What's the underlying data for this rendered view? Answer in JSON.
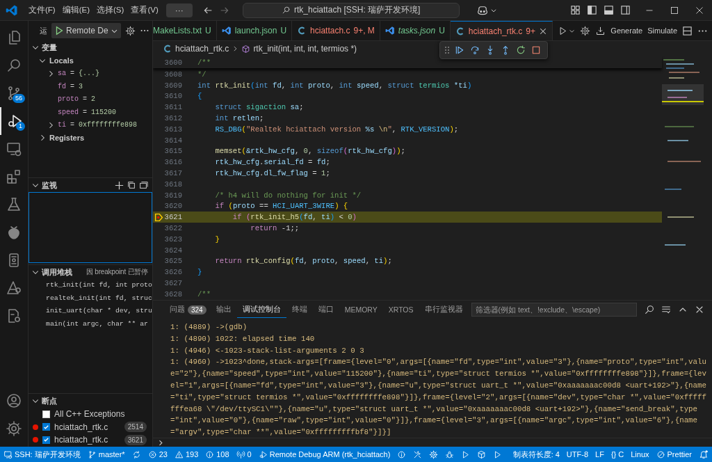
{
  "title_bar": {
    "menus": [
      "文件(F)",
      "编辑(E)",
      "选择(S)",
      "查看(V)"
    ],
    "more": "···",
    "command_center": "rtk_hciattach [SSH: 瑞萨开发环境]"
  },
  "activity_bar": {
    "top": [
      {
        "kind": "explorer",
        "selected": false
      },
      {
        "kind": "search",
        "selected": false
      },
      {
        "kind": "source-control",
        "selected": false,
        "badge": "56"
      },
      {
        "kind": "debug",
        "selected": true,
        "badge": "1"
      },
      {
        "kind": "remote",
        "selected": false
      },
      {
        "kind": "extensions",
        "selected": false
      },
      {
        "kind": "testing",
        "selected": false
      },
      {
        "kind": "berry",
        "selected": false
      },
      {
        "kind": "device",
        "selected": false
      },
      {
        "kind": "triangle",
        "selected": false
      },
      {
        "kind": "file-gear",
        "selected": false
      }
    ],
    "bottom": [
      {
        "kind": "account",
        "selected": false
      },
      {
        "kind": "settings",
        "selected": false
      }
    ]
  },
  "sidebar": {
    "title": "运",
    "configuration": "Remote De",
    "variables": {
      "title": "变量",
      "expanded": true,
      "scopes": [
        {
          "label": "Locals",
          "expanded": true,
          "items": [
            {
              "name": "sa",
              "operator": "=",
              "value": "{...}",
              "expandable": true
            },
            {
              "name": "fd",
              "operator": "=",
              "value": "3",
              "expandable": false
            },
            {
              "name": "proto",
              "operator": "=",
              "value": "2",
              "expandable": false
            },
            {
              "name": "speed",
              "operator": "=",
              "value": "115200",
              "expandable": false
            },
            {
              "name": "ti",
              "operator": "=",
              "value": "0xffffffffe898",
              "expandable": true
            }
          ]
        },
        {
          "label": "Registers",
          "expanded": false
        }
      ]
    },
    "watch": {
      "title": "监视",
      "expanded": true
    },
    "call_stack": {
      "title": "调用堆栈",
      "expanded": true,
      "status": "因 breakpoint 已暂停",
      "frames": [
        "rtk_init(int fd, int proto",
        "realtek_init(int fd, struc",
        "init_uart(char * dev, stru",
        "main(int argc, char ** ar"
      ]
    },
    "breakpoints": {
      "title": "断点",
      "expanded": true,
      "items": [
        {
          "label": "All C++ Exceptions",
          "kind": "exception",
          "checked": false
        },
        {
          "label": "hciattach_rtk.c",
          "kind": "line",
          "checked": true,
          "line": "2514"
        },
        {
          "label": "hciattach_rtk.c",
          "kind": "line",
          "checked": true,
          "line": "3621"
        }
      ]
    }
  },
  "editor": {
    "tabs": [
      {
        "label": "MakeLists.txt",
        "status": "U",
        "color": "#73c991",
        "preview": false,
        "selected": false
      },
      {
        "label": "launch.json",
        "kind": "json",
        "status": "U",
        "color": "#73c991",
        "preview": false,
        "selected": false
      },
      {
        "label": "hciattach.c",
        "kind": "c",
        "status": "9+, M",
        "color": "#f88070",
        "preview": false,
        "selected": false
      },
      {
        "label": "tasks.json",
        "kind": "json",
        "status": "U",
        "color": "#73c991",
        "preview": true,
        "selected": false
      },
      {
        "label": "hciattach_rtk.c",
        "kind": "c",
        "status": "9+",
        "color": "#f88070",
        "preview": false,
        "selected": true
      }
    ],
    "actions": [
      {
        "kind": "run"
      },
      {
        "kind": "settings"
      },
      {
        "kind": "download"
      },
      {
        "kind": "text",
        "label": "Generate"
      },
      {
        "kind": "text",
        "label": "Simulate"
      },
      {
        "kind": "split"
      },
      {
        "kind": "more"
      }
    ],
    "breadcrumbs": [
      {
        "kind": "file",
        "label": "hciattach_rtk.c"
      },
      {
        "kind": "function",
        "label": "rtk_init(int, int, int, termios *)"
      }
    ],
    "debug_toolbar": [
      {
        "kind": "continue"
      },
      {
        "kind": "step-over"
      },
      {
        "kind": "step-into"
      },
      {
        "kind": "step-out"
      },
      {
        "kind": "restart"
      },
      {
        "kind": "stop"
      }
    ],
    "sticky_line": {
      "number": "3600",
      "tokens": [
        {
          "text": "/**",
          "kind": "cmt"
        }
      ]
    },
    "code_lines": [
      {
        "number": "3608",
        "current": false,
        "tokens": [
          {
            "text": "*/",
            "kind": "cmt"
          }
        ]
      },
      {
        "number": "3609",
        "current": false,
        "tokens": [
          {
            "text": "int",
            "kind": "kw"
          },
          {
            "text": " rtk_init",
            "kind": "fn"
          },
          {
            "text": "(",
            "kind": "paren3"
          },
          {
            "text": "int",
            "kind": "kw"
          },
          {
            "text": " fd",
            "kind": "var"
          },
          {
            "text": ", ",
            "kind": "plain"
          },
          {
            "text": "int",
            "kind": "kw"
          },
          {
            "text": " proto",
            "kind": "var"
          },
          {
            "text": ", ",
            "kind": "plain"
          },
          {
            "text": "int",
            "kind": "kw"
          },
          {
            "text": " speed",
            "kind": "var"
          },
          {
            "text": ", ",
            "kind": "plain"
          },
          {
            "text": "struct",
            "kind": "kw"
          },
          {
            "text": " termios",
            "kind": "type"
          },
          {
            "text": " *ti",
            "kind": "var"
          },
          {
            "text": ")",
            "kind": "paren3"
          }
        ]
      },
      {
        "number": "3610",
        "current": false,
        "tokens": [
          {
            "text": "{",
            "kind": "paren3"
          }
        ]
      },
      {
        "number": "3611",
        "current": false,
        "tokens": [
          {
            "text": "    struct",
            "kind": "kw"
          },
          {
            "text": " sigaction",
            "kind": "type"
          },
          {
            "text": " sa",
            "kind": "var"
          },
          {
            "text": ";",
            "kind": "plain"
          }
        ]
      },
      {
        "number": "3612",
        "current": false,
        "tokens": [
          {
            "text": "    int",
            "kind": "kw"
          },
          {
            "text": " retlen",
            "kind": "var"
          },
          {
            "text": ";",
            "kind": "plain"
          }
        ]
      },
      {
        "number": "3613",
        "current": false,
        "tokens": [
          {
            "text": "    RS_DBG",
            "kind": "macro"
          },
          {
            "text": "(",
            "kind": "brace"
          },
          {
            "text": "\"Realtek hciattach version ",
            "kind": "str"
          },
          {
            "text": "%s",
            "kind": "var"
          },
          {
            "text": " \\n",
            "kind": "esc"
          },
          {
            "text": "\"",
            "kind": "str"
          },
          {
            "text": ", ",
            "kind": "plain"
          },
          {
            "text": "RTK_VERSION",
            "kind": "macro"
          },
          {
            "text": ")",
            "kind": "brace"
          },
          {
            "text": ";",
            "kind": "plain"
          }
        ]
      },
      {
        "number": "3614",
        "current": false
      },
      {
        "number": "3615",
        "current": false,
        "tokens": [
          {
            "text": "    memset",
            "kind": "fn"
          },
          {
            "text": "(",
            "kind": "brace"
          },
          {
            "text": "&rtk_hw_cfg",
            "kind": "var"
          },
          {
            "text": ", ",
            "kind": "plain"
          },
          {
            "text": "0",
            "kind": "num"
          },
          {
            "text": ", ",
            "kind": "plain"
          },
          {
            "text": "sizeof",
            "kind": "kw"
          },
          {
            "text": "(",
            "kind": "paren2"
          },
          {
            "text": "rtk_hw_cfg",
            "kind": "var"
          },
          {
            "text": ")",
            "kind": "paren2"
          },
          {
            "text": ")",
            "kind": "brace"
          },
          {
            "text": ";",
            "kind": "plain"
          }
        ]
      },
      {
        "number": "3616",
        "current": false,
        "tokens": [
          {
            "text": "    rtk_hw_cfg",
            "kind": "var"
          },
          {
            "text": ".",
            "kind": "plain"
          },
          {
            "text": "serial_fd",
            "kind": "var"
          },
          {
            "text": " = ",
            "kind": "plain"
          },
          {
            "text": "fd",
            "kind": "var"
          },
          {
            "text": ";",
            "kind": "plain"
          }
        ]
      },
      {
        "number": "3617",
        "current": false,
        "tokens": [
          {
            "text": "    rtk_hw_cfg",
            "kind": "var"
          },
          {
            "text": ".",
            "kind": "plain"
          },
          {
            "text": "dl_fw_flag",
            "kind": "var"
          },
          {
            "text": " = ",
            "kind": "plain"
          },
          {
            "text": "1",
            "kind": "num"
          },
          {
            "text": ";",
            "kind": "plain"
          }
        ]
      },
      {
        "number": "3618",
        "current": false
      },
      {
        "number": "3619",
        "current": false,
        "tokens": [
          {
            "text": "    /* h4 will do nothing for init */",
            "kind": "cmt"
          }
        ]
      },
      {
        "number": "3620",
        "current": false,
        "tokens": [
          {
            "text": "    if",
            "kind": "ctrl"
          },
          {
            "text": " (",
            "kind": "brace"
          },
          {
            "text": "proto",
            "kind": "var"
          },
          {
            "text": " == ",
            "kind": "plain"
          },
          {
            "text": "HCI_UART_3WIRE",
            "kind": "macro"
          },
          {
            "text": ")",
            "kind": "brace"
          },
          {
            "text": " {",
            "kind": "brace"
          }
        ]
      },
      {
        "number": "3621",
        "current": true,
        "tokens": [
          {
            "text": "        if",
            "kind": "ctrl"
          },
          {
            "text": " (",
            "kind": "paren2"
          },
          {
            "text": "rtk_init_h5",
            "kind": "fn"
          },
          {
            "text": "(",
            "kind": "paren3"
          },
          {
            "text": "fd",
            "kind": "var"
          },
          {
            "text": ", ",
            "kind": "plain"
          },
          {
            "text": "ti",
            "kind": "var"
          },
          {
            "text": ")",
            "kind": "paren3"
          },
          {
            "text": " < ",
            "kind": "plain"
          },
          {
            "text": "0",
            "kind": "num"
          },
          {
            "text": ")",
            "kind": "paren2"
          }
        ]
      },
      {
        "number": "3622",
        "current": false,
        "tokens": [
          {
            "text": "            return",
            "kind": "ctrl"
          },
          {
            "text": " -1;;",
            "kind": "plain"
          }
        ]
      },
      {
        "number": "3623",
        "current": false,
        "tokens": [
          {
            "text": "    }",
            "kind": "brace"
          }
        ]
      },
      {
        "number": "3624",
        "current": false
      },
      {
        "number": "3625",
        "current": false,
        "tokens": [
          {
            "text": "    return",
            "kind": "ctrl"
          },
          {
            "text": " rtk_config",
            "kind": "fn"
          },
          {
            "text": "(",
            "kind": "brace"
          },
          {
            "text": "fd",
            "kind": "var"
          },
          {
            "text": ", ",
            "kind": "plain"
          },
          {
            "text": "proto",
            "kind": "var"
          },
          {
            "text": ", ",
            "kind": "plain"
          },
          {
            "text": "speed",
            "kind": "var"
          },
          {
            "text": ", ",
            "kind": "plain"
          },
          {
            "text": "ti",
            "kind": "var"
          },
          {
            "text": ")",
            "kind": "brace"
          },
          {
            "text": ";",
            "kind": "plain"
          }
        ]
      },
      {
        "number": "3626",
        "current": false,
        "tokens": [
          {
            "text": "}",
            "kind": "paren3"
          }
        ]
      },
      {
        "number": "3627",
        "current": false
      },
      {
        "number": "3628",
        "current": false,
        "tokens": [
          {
            "text": "/**",
            "kind": "cmt"
          }
        ]
      }
    ]
  },
  "panel": {
    "tabs": [
      {
        "label": "问题",
        "badge": "324",
        "selected": false
      },
      {
        "label": "输出",
        "selected": false
      },
      {
        "label": "调试控制台",
        "selected": true
      },
      {
        "label": "终端",
        "selected": false
      },
      {
        "label": "端口",
        "selected": false
      },
      {
        "label": "MEMORY",
        "selected": false
      },
      {
        "label": "XRTOS",
        "selected": false
      },
      {
        "label": "串行监视器",
        "selected": false
      }
    ],
    "filter": {
      "placeholder": "筛选器(例如 text、!exclude、\\escape)"
    },
    "actions": [
      {
        "kind": "find"
      },
      {
        "kind": "list"
      },
      {
        "kind": "maximize"
      },
      {
        "kind": "close"
      }
    ],
    "console_lines": [
      "1: (4889) ->(gdb)",
      "1: (4890) 1022: elapsed time 140",
      "1: (4946) <-1023-stack-list-arguments 2 0 3",
      "1: (4960) ->1023^done,stack-args=[frame={level=\"0\",args=[{name=\"fd\",type=\"int\",value=\"3\"},{name=\"proto\",type=\"int\",value=\"2\"},{name=\"speed\",type=\"int\",value=\"115200\"},{name=\"ti\",type=\"struct termios *\",value=\"0xffffffffe898\"}]},frame={level=\"1\",args=[{name=\"fd\",type=\"int\",value=\"3\"},{name=\"u\",type=\"struct uart_t *\",value=\"0xaaaaaaac00d8 <uart+192>\"},{name=\"ti\",type=\"struct termios *\",value=\"0xffffffffe898\"}]},frame={level=\"2\",args=[{name=\"dev\",type=\"char *\",value=\"0xffffffffea68 \\\"/dev/ttySC1\\\"\"},{name=\"u\",type=\"struct uart_t *\",value=\"0xaaaaaaac00d8 <uart+192>\"},{name=\"send_break\",type=\"int\",value=\"0\"},{name=\"raw\",type=\"int\",value=\"0\"}]},frame={level=\"3\",args=[{name=\"argc\",type=\"int\",value=\"6\"},{name=\"argv\",type=\"char **\",value=\"0xfffffffffbf8\"}]}]"
    ]
  },
  "status_bar": {
    "left": [
      {
        "kind": "remote",
        "label": "SSH: 瑞萨开发环境"
      },
      {
        "kind": "branch",
        "label": "master*"
      },
      {
        "kind": "sync"
      },
      {
        "kind": "errors",
        "label": "23"
      },
      {
        "kind": "warnings",
        "label": "193"
      },
      {
        "kind": "infos",
        "label": "108"
      },
      {
        "kind": "ports",
        "label": "0"
      },
      {
        "kind": "debug",
        "label": "Remote Debug ARM (rtk_hciattach)"
      },
      {
        "kind": "info"
      },
      {
        "kind": "tools"
      },
      {
        "kind": "gear"
      },
      {
        "kind": "bug"
      },
      {
        "kind": "play"
      },
      {
        "kind": "package"
      },
      {
        "kind": "play"
      }
    ],
    "right": [
      {
        "kind": "text",
        "label": "制表符长度: 4"
      },
      {
        "kind": "text",
        "label": "UTF-8"
      },
      {
        "kind": "text",
        "label": "LF"
      },
      {
        "kind": "text",
        "label": "{} C"
      },
      {
        "kind": "text",
        "label": "Linux"
      },
      {
        "kind": "prettier",
        "label": "Prettier"
      },
      {
        "kind": "bell"
      }
    ]
  }
}
